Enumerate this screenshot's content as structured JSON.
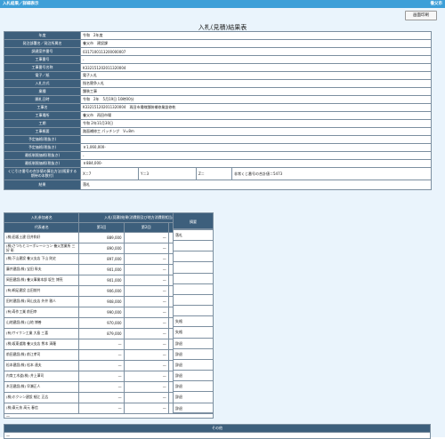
{
  "header": {
    "breadcrumb": "入札結果／詳細表示",
    "right_label": "養父市"
  },
  "back_button": "画面印刷",
  "page_title": "入札(見積)結果表",
  "info_rows": [
    {
      "label": "年度",
      "value": "令和　2年度"
    },
    {
      "label": "発注部署名／発注所属名",
      "value": "養父市　建設課"
    },
    {
      "label": "調達案件番号",
      "value": "0317100113200000007"
    },
    {
      "label": "工事番号",
      "value": "-"
    },
    {
      "label": "工事番号名称",
      "value": "K332151202011320004"
    },
    {
      "label": "電子／紙",
      "value": "電子入札"
    },
    {
      "label": "入札方式",
      "value": "指名競争入札"
    },
    {
      "label": "業種",
      "value": "舗装工事"
    },
    {
      "label": "開札日時",
      "value": "令和　2年　5月19日 10時00分"
    },
    {
      "label": "工事名",
      "value": "K332151202011320004　再田市場線舗装補修業談修乾"
    },
    {
      "label": "工事場所",
      "value": "養父市　再田市場"
    },
    {
      "label": "工期",
      "value": "令和 2年11月30日"
    },
    {
      "label": "工事概要",
      "value": "路面補修工 パッチング　V=8m"
    },
    {
      "label": "予定価格(税抜き)",
      "value": ""
    },
    {
      "label": "予定価格(税抜き)",
      "value": "￥1,060,000-"
    },
    {
      "label": "最低制限価格(税抜き)",
      "value": "-"
    },
    {
      "label": "最低制限価格(税抜き)",
      "value": "￥884,000-"
    }
  ],
  "random_row": {
    "label": "くじ引き番号の合計値の算出方法(随意する期待の本数付)",
    "x": "X＝7",
    "y": "Y＝3",
    "z": "Z＝",
    "total": "非常くじ番号の合計値＝5473"
  },
  "winner_row": {
    "label": "結果",
    "value": "落札"
  },
  "bid_table": {
    "h_participants": "入札参加者名",
    "h_results": "入札(見積)結果(消費税及び地方消費税相当額を除く)",
    "h_rep": "代表者名",
    "h_round1": "第1回",
    "h_round2": "第2回",
    "h_round3": "第3回",
    "h_remarks": "摘要",
    "rows": [
      {
        "name": "(株)田坂土建 田井和好",
        "r1": "889,000",
        "r2": "—",
        "r3": "—",
        "remark": "落札"
      },
      {
        "name": "(株)さつもとコーポレーション 養父営業所 三好 彰",
        "r1": "890,000",
        "r2": "—",
        "r3": "—",
        "remark": ""
      },
      {
        "name": "(株)下山建設 養父支店 下山 則史",
        "r1": "897,000",
        "r2": "—",
        "r3": "—",
        "remark": ""
      },
      {
        "name": "藤井建設(株) 宝田 幹夫",
        "r1": "901,000",
        "r2": "—",
        "r3": "—",
        "remark": ""
      },
      {
        "name": "岡田建設(株) 養父事業本部 坂生 博亮",
        "r1": "901,000",
        "r2": "—",
        "r3": "—",
        "remark": ""
      },
      {
        "name": "(有)桐足建設 吉田前共",
        "r1": "906,000",
        "r2": "—",
        "r3": "—",
        "remark": ""
      },
      {
        "name": "田村建設(株) 岡山支店 外井 雅人",
        "r1": "908,000",
        "r2": "—",
        "r3": "—",
        "remark": ""
      },
      {
        "name": "(有)寿作工業 前田幸",
        "r1": "990,000",
        "r2": "—",
        "r3": "—",
        "remark": ""
      },
      {
        "name": "山地建設(株) 山地 博善",
        "r1": "970,000",
        "r2": "—",
        "r3": "—",
        "remark": "失格"
      },
      {
        "name": "(有)サイケン工業 大島 三喜",
        "r1": "879,000",
        "r2": "—",
        "r3": "—",
        "remark": "失格"
      },
      {
        "name": "(株)坂東道路 養父支店 熊本 清羅",
        "r1": "—",
        "r2": "—",
        "r3": "—",
        "remark": "辞退"
      },
      {
        "name": "前田建設(株) 前江孝司",
        "r1": "—",
        "r2": "—",
        "r3": "—",
        "remark": "辞退"
      },
      {
        "name": "松本建設(株) 松本 達夫",
        "r1": "—",
        "r2": "—",
        "r3": "—",
        "remark": "辞退"
      },
      {
        "name": "内育工木道(株) 井上澤司",
        "r1": "—",
        "r2": "—",
        "r3": "—",
        "remark": "辞退"
      },
      {
        "name": "木沼建設(株) 早瀬正人",
        "r1": "—",
        "r2": "—",
        "r3": "—",
        "remark": "辞退"
      },
      {
        "name": "(株)ホクシン建設 細江 正広",
        "r1": "—",
        "r2": "—",
        "r3": "—",
        "remark": "辞退"
      },
      {
        "name": "(株)東元技 高元 春信",
        "r1": "—",
        "r2": "—",
        "r3": "—",
        "remark": "辞退"
      }
    ],
    "footer": "—"
  },
  "other": {
    "header": "その他",
    "value": "—"
  },
  "colors": {
    "topbar": "#3d9fd8",
    "label_bg": "#3d5f7c",
    "page_bg": "#eaf4fc"
  }
}
